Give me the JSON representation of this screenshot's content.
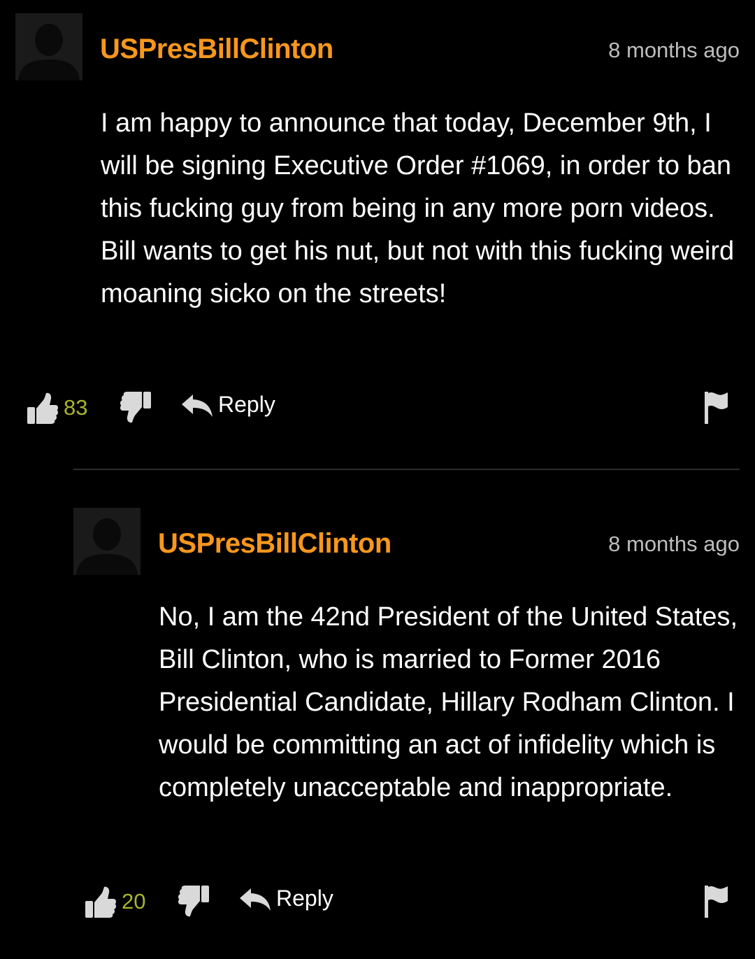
{
  "comments": [
    {
      "username": "USPresBillClinton",
      "timestamp": "8 months ago",
      "text": "I am happy to announce that today, December 9th, I will be signing Executive Order #1069, in order to ban this fucking guy from being in any more porn videos. Bill wants to get his nut, but not with this fucking weird moaning sicko on the streets!",
      "likes": "83",
      "reply_label": "Reply",
      "avatar_icon": "default-user-silhouette-icon"
    },
    {
      "username": "USPresBillClinton",
      "timestamp": "8 months ago",
      "text": "No, I am the 42nd President of the United States, Bill Clinton, who is married to Former 2016 Presidential Candidate, Hillary Rodham Clinton. I would be committing an act of infidelity which is completely unacceptable and inappropriate.",
      "likes": "20",
      "reply_label": "Reply",
      "avatar_icon": "default-user-silhouette-icon"
    }
  ],
  "colors": {
    "background": "#000000",
    "username": "#f7971d",
    "like_count": "#a7b52b",
    "timestamp": "#bdbdbd",
    "icons": "#d9d9d9"
  }
}
